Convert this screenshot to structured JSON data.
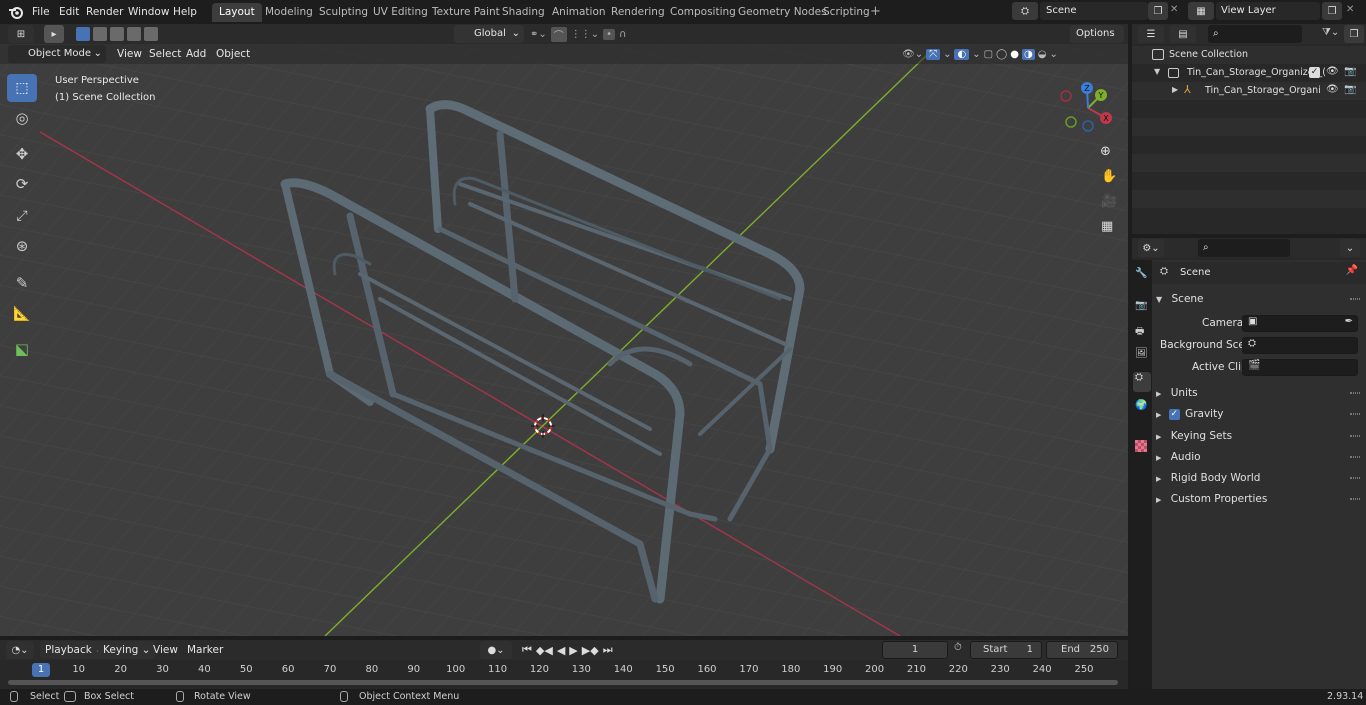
{
  "topbar": {
    "menus": [
      "File",
      "Edit",
      "Render",
      "Window",
      "Help"
    ],
    "workspaces": [
      "Layout",
      "Modeling",
      "Sculpting",
      "UV Editing",
      "Texture Paint",
      "Shading",
      "Animation",
      "Rendering",
      "Compositing",
      "Geometry Nodes",
      "Scripting"
    ],
    "active_workspace": "Layout",
    "scene_name": "Scene",
    "view_layer": "View Layer"
  },
  "viewport_header": {
    "mode": "Object Mode",
    "menus": [
      "View",
      "Select",
      "Add",
      "Object"
    ],
    "transform_orientation": "Global",
    "options": "Options"
  },
  "viewport": {
    "perspective": "User Perspective",
    "collection": "(1) Scene Collection",
    "gizmo": {
      "x": "X",
      "y": "Y",
      "z": "Z"
    }
  },
  "outliner": {
    "root": "Scene Collection",
    "collection": "Tin_Can_Storage_Organizer_(",
    "object": "Tin_Can_Storage_Organi"
  },
  "properties": {
    "header": "Scene",
    "panel": "Scene",
    "camera_label": "Camera",
    "background_scene_label": "Background Scene",
    "active_clip_label": "Active Clip",
    "sections": [
      "Units",
      "Gravity",
      "Keying Sets",
      "Audio",
      "Rigid Body World",
      "Custom Properties"
    ],
    "gravity_enabled": true
  },
  "timeline": {
    "menus": [
      "Playback",
      "Keying",
      "View",
      "Marker"
    ],
    "current_frame": "1",
    "start_label": "Start",
    "start": "1",
    "end_label": "End",
    "end": "250",
    "ruler": [
      "1",
      "10",
      "20",
      "30",
      "40",
      "50",
      "60",
      "70",
      "80",
      "90",
      "100",
      "110",
      "120",
      "130",
      "140",
      "150",
      "160",
      "170",
      "180",
      "190",
      "200",
      "210",
      "220",
      "230",
      "240",
      "250"
    ]
  },
  "statusbar": {
    "select": "Select",
    "box_select": "Box Select",
    "rotate_view": "Rotate View",
    "context_menu": "Object Context Menu",
    "version": "2.93.14"
  },
  "colors": {
    "accent": "#4772b3",
    "x_axis": "#c0394a",
    "y_axis": "#7fae2a",
    "z_axis": "#3b7ddb",
    "viewport_bg": "#3e3e3e"
  }
}
